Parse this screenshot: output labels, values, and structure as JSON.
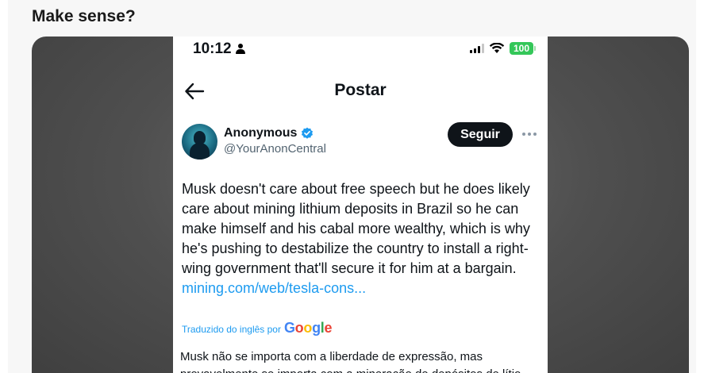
{
  "post": {
    "question": "Make sense?"
  },
  "screenshot": {
    "status_bar": {
      "time": "10:12",
      "battery": "100"
    },
    "header": {
      "title": "Postar"
    },
    "author": {
      "name": "Anonymous",
      "handle": "@YourAnonCentral"
    },
    "follow_label": "Seguir",
    "tweet": {
      "text": "Musk doesn't care about free speech but he does likely care about mining lithium deposits in Brazil so he can make himself and his cabal more wealthy, which is why he's pushing to destabilize the country to install a right-wing government that'll secure it for him at a bargain.",
      "link": "mining.com/web/tesla-cons..."
    },
    "translation": {
      "label": "Traduzido do inglês por",
      "provider": "Google",
      "text": "Musk não se importa com a liberdade de expressão, mas provavelmente se importa com a mineração de depósitos de lítio"
    }
  },
  "colors": {
    "link": "#1d9bf0",
    "battery": "#34c759",
    "follow_button": "#0f1419"
  },
  "icons": [
    "person-icon",
    "signal-icon",
    "wifi-icon",
    "battery-icon",
    "back-arrow-icon",
    "verified-icon",
    "more-icon"
  ]
}
